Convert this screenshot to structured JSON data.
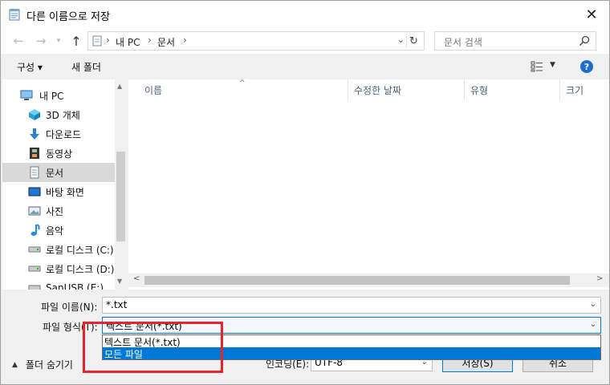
{
  "window": {
    "title": "다른 이름으로 저장",
    "close_symbol": "✕"
  },
  "nav": {
    "back_icon": "arrow-left-icon",
    "forward_icon": "arrow-right-icon",
    "recent_icon": "chevron-down-icon",
    "up_icon": "arrow-up-icon",
    "breadcrumb": [
      "내 PC",
      "문서"
    ],
    "search_placeholder": "문서 검색"
  },
  "toolbar": {
    "organize_label": "구성 ▾",
    "new_folder_label": "새 폴더",
    "help_label": "?"
  },
  "sidebar": {
    "items": [
      {
        "label": "내 PC",
        "icon": "computer-icon",
        "selected": false
      },
      {
        "label": "3D 개체",
        "icon": "cube-3d-icon",
        "selected": false
      },
      {
        "label": "다운로드",
        "icon": "download-arrow-icon",
        "selected": false
      },
      {
        "label": "동영상",
        "icon": "film-icon",
        "selected": false
      },
      {
        "label": "문서",
        "icon": "document-icon",
        "selected": true
      },
      {
        "label": "바탕 화면",
        "icon": "desktop-icon",
        "selected": false
      },
      {
        "label": "사진",
        "icon": "picture-icon",
        "selected": false
      },
      {
        "label": "음악",
        "icon": "music-note-icon",
        "selected": false
      },
      {
        "label": "로컬 디스크 (C:)",
        "icon": "drive-icon",
        "selected": false
      },
      {
        "label": "로컬 디스크 (D:)",
        "icon": "drive-icon",
        "selected": false
      },
      {
        "label": "SanUSB (E:)",
        "icon": "usb-drive-icon",
        "selected": false
      }
    ]
  },
  "file_list": {
    "columns": [
      "이름",
      "수정한 날짜",
      "유형",
      "크기"
    ],
    "rows": []
  },
  "form": {
    "filename_label": "파일 이름(N):",
    "filename_value": "*.txt",
    "filetype_label": "파일 형식(T):",
    "filetype_value": "텍스트 문서(*.txt)",
    "filetype_options": [
      "텍스트 문서(*.txt)",
      "모든 파일"
    ],
    "filetype_selected_index": 1,
    "encoding_label": "인코딩(E):",
    "encoding_value": "UTF-8",
    "hide_folders_label": "폴더 숨기기",
    "save_label": "저장(S)",
    "cancel_label": "취소"
  },
  "colors": {
    "accent": "#0078d7",
    "highlight": "#e8242a",
    "selected_row": "#d9d9d9"
  }
}
